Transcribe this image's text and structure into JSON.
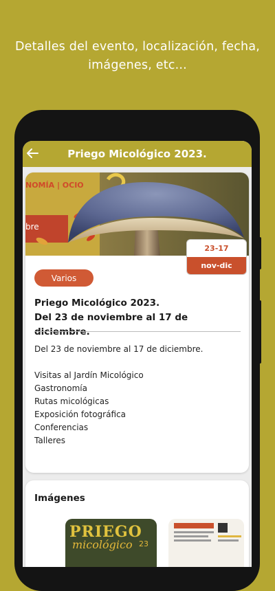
{
  "promo": {
    "line1": "Detalles del evento, localización, fecha,",
    "line2": "imágenes, etc..."
  },
  "appbar": {
    "title": "Priego Micológico 2023.",
    "back_icon": "arrow-left-icon"
  },
  "event": {
    "banner_text_1": "NOMÍA | OCIO",
    "banner_text_2": "bre",
    "date_range": "23-17",
    "month_range": "nov-dic",
    "category": "Varios",
    "title_line1": "Priego Micológico 2023.",
    "title_line2": "Del 23 de noviembre al 17 de diciembre.",
    "description": [
      "Del 23 de noviembre al 17 de diciembre.",
      "",
      "Visitas al Jardín Micológico",
      "Gastronomía",
      "Rutas micológicas",
      "Exposición fotográfica",
      "Conferencias",
      "Talleres"
    ]
  },
  "images": {
    "heading": "Imágenes",
    "poster_title_1": "PRIEGO",
    "poster_title_2": "micológico",
    "poster_year": "23"
  },
  "colors": {
    "brand": "#b5a732",
    "accent": "#c9502c",
    "tag": "#d05a35"
  }
}
